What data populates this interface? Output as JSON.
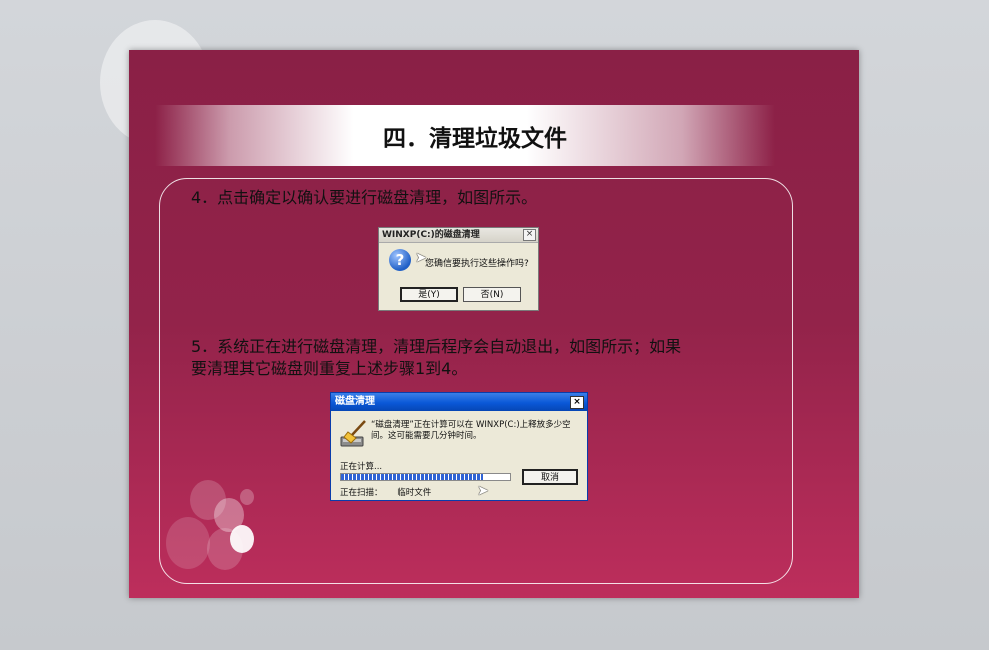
{
  "slide": {
    "title": "四．清理垃圾文件",
    "step4_text": "4．点击确定以确认要进行磁盘清理，如图所示。",
    "step5_line1": "5．系统正在进行磁盘清理，清理后程序会自动退出，如图所示；如果",
    "step5_line2": "要清理其它磁盘则重复上述步骤1到4。"
  },
  "confirm_dialog": {
    "title": "WINXP(C:)的磁盘清理",
    "close_label": "×",
    "icon": "question-icon",
    "message": "您确信要执行这些操作吗?",
    "yes_label": "是(Y)",
    "no_label": "否(N)"
  },
  "cleanup_dialog": {
    "title": "磁盘清理",
    "close_label": "×",
    "icon": "disk-cleanup-broom-icon",
    "message": "“磁盘清理”正在计算可以在 WINXP(C:)上释放多少空间。这可能需要几分钟时间。",
    "status_label": "正在计算...",
    "cancel_label": "取消",
    "scanning_label": "正在扫描：",
    "scanning_item": "临时文件",
    "progress": 0.84
  },
  "colors": {
    "slide_top": "#8a2046",
    "slide_bottom": "#bd2e5c",
    "xp_title_blue": "#0a58d8"
  }
}
